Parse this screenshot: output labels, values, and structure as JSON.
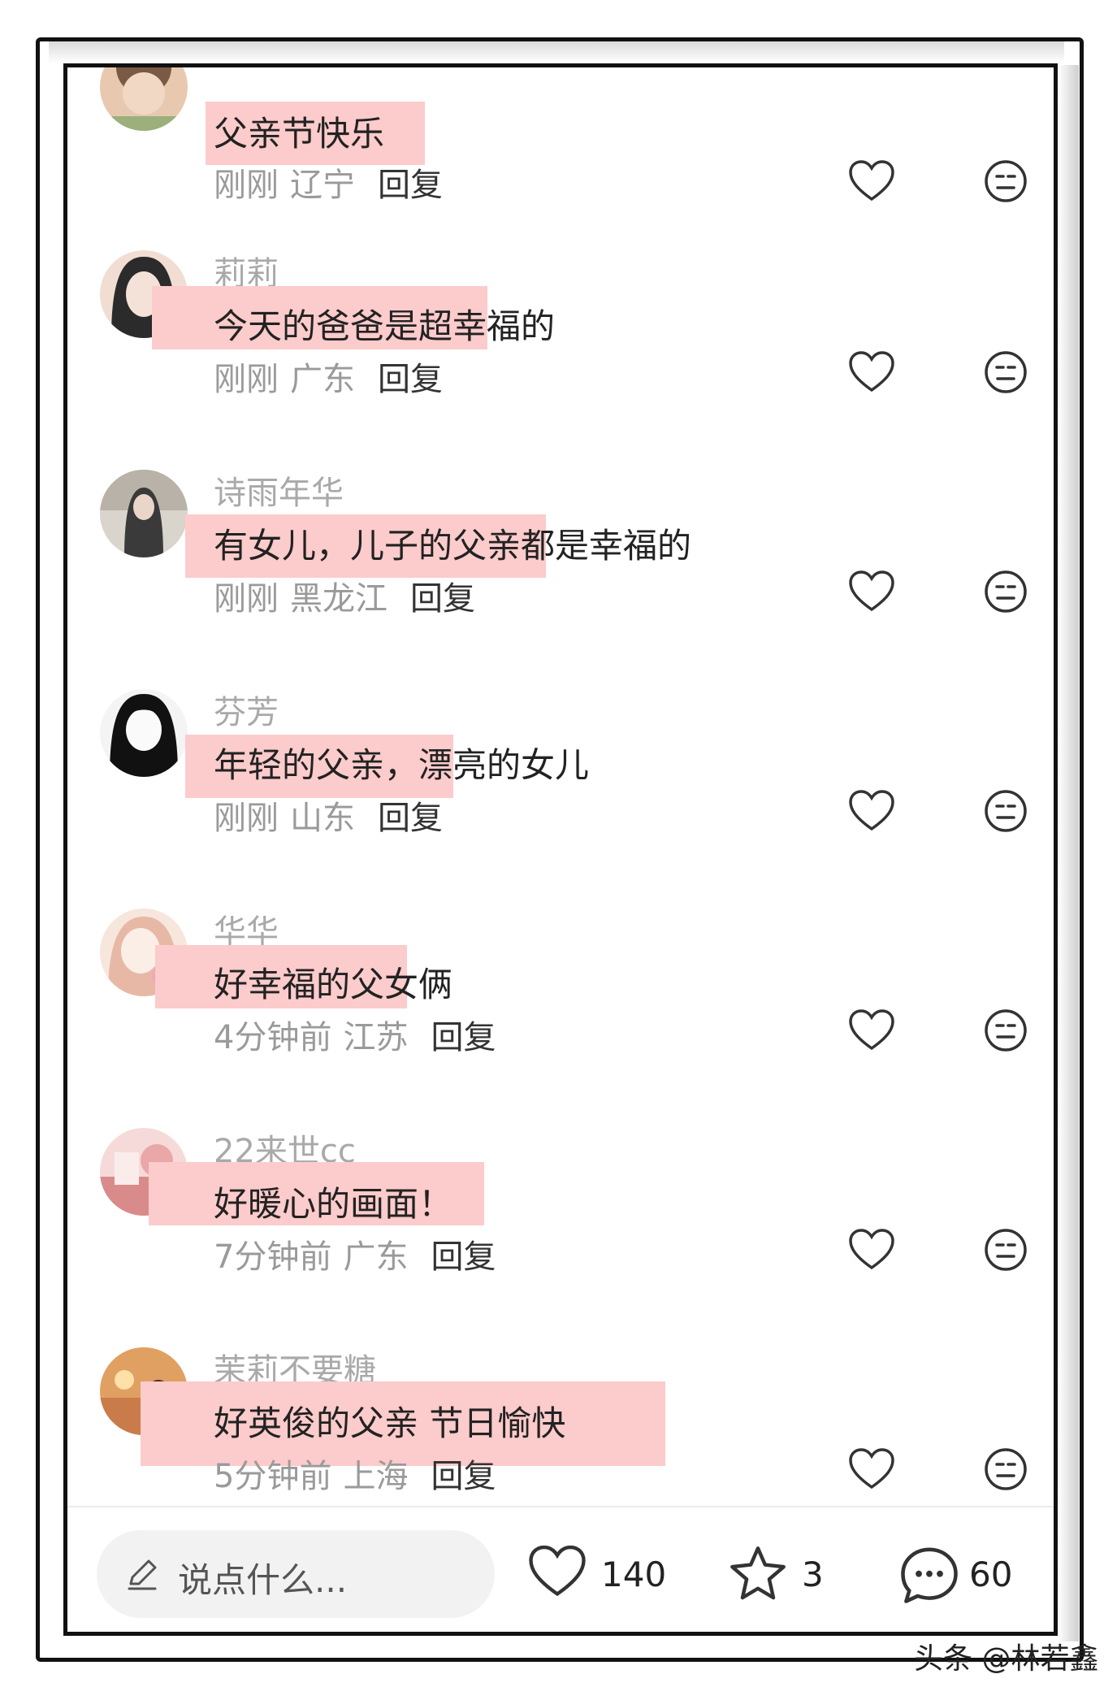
{
  "comments": [
    {
      "username": "",
      "text": "父亲节快乐",
      "time": "刚刚",
      "location": "辽宁",
      "reply": "回复",
      "avatar_colors": [
        "#7a5a45",
        "#e8c9b0"
      ]
    },
    {
      "username": "莉莉",
      "text": "今天的爸爸是超幸福的",
      "time": "刚刚",
      "location": "广东",
      "reply": "回复",
      "avatar_colors": [
        "#2b2b2b",
        "#f1ddd2"
      ]
    },
    {
      "username": "诗雨年华",
      "text": "有女儿，儿子的父亲都是幸福的",
      "time": "刚刚",
      "location": "黑龙江",
      "reply": "回复",
      "avatar_colors": [
        "#3a3a3a",
        "#d9d4cc"
      ]
    },
    {
      "username": "芬芳",
      "text": "年轻的父亲，漂亮的女儿",
      "time": "刚刚",
      "location": "山东",
      "reply": "回复",
      "avatar_colors": [
        "#111111",
        "#f4f4f4"
      ]
    },
    {
      "username": "华华",
      "text": "好幸福的父女俩",
      "time": "4分钟前",
      "location": "江苏",
      "reply": "回复",
      "avatar_colors": [
        "#e8b8a6",
        "#f7e6dc"
      ]
    },
    {
      "username": "22来世cc",
      "text": "好暖心的画面！",
      "time": "7分钟前",
      "location": "广东",
      "reply": "回复",
      "avatar_colors": [
        "#d98b8b",
        "#f6dada"
      ]
    },
    {
      "username": "茉莉不要糖",
      "text": "好英俊的父亲 节日愉快",
      "time": "5分钟前",
      "location": "上海",
      "reply": "回复",
      "avatar_colors": [
        "#e0a062",
        "#4a2e2a"
      ]
    }
  ],
  "bottom_bar": {
    "input_placeholder": "说点什么...",
    "likes": "140",
    "stars": "3",
    "comments": "60"
  },
  "watermark": "头条 @林若鑫",
  "colors": {
    "highlight": "#fccbcb",
    "meta_text": "#9a9a9a",
    "icon": "#333333"
  },
  "icons": {
    "like": "heart-outline-icon",
    "dislike": "meh-face-icon",
    "edit": "pencil-icon",
    "favorite": "star-outline-icon",
    "comment": "speech-bubble-icon"
  }
}
